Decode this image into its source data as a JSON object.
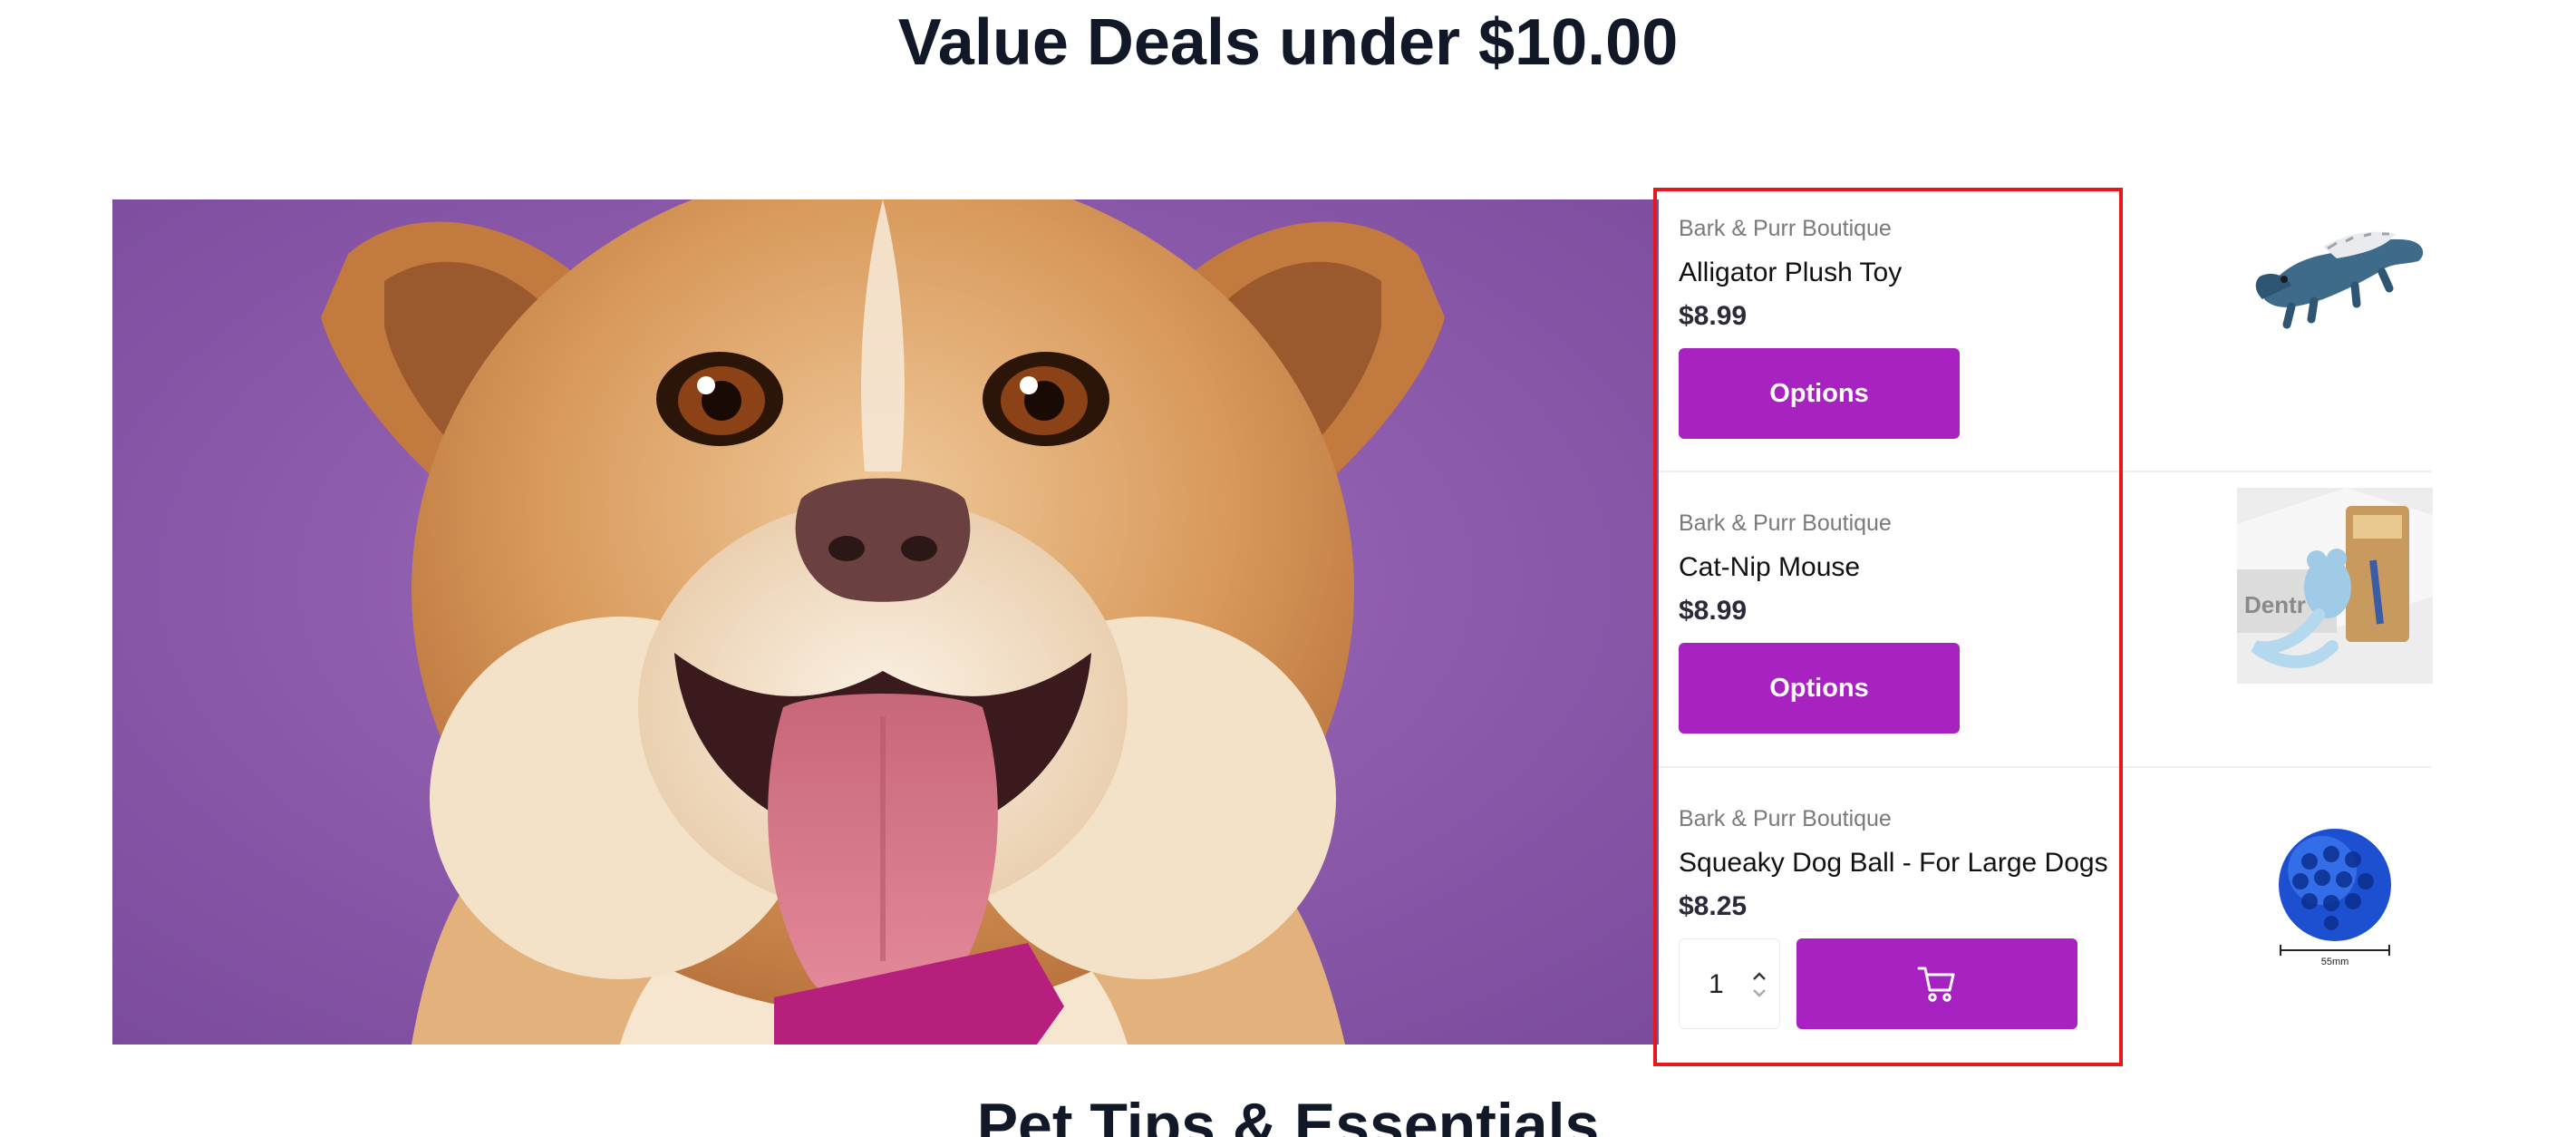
{
  "sections": {
    "value_deals_title": "Value Deals under $10.00",
    "pet_tips_title": "Pet Tips & Essentials"
  },
  "hero": {
    "image": "smiling-dog-portrait",
    "background_color": "#8a55a8"
  },
  "products": [
    {
      "vendor": "Bark & Purr Boutique",
      "name": "Alligator Plush Toy",
      "price": "$8.99",
      "button_label": "Options",
      "image": "alligator-plush-toy"
    },
    {
      "vendor": "Bark & Purr Boutique",
      "name": "Cat-Nip Mouse",
      "price": "$8.99",
      "button_label": "Options",
      "image": "cat-nip-mouse"
    },
    {
      "vendor": "Bark & Purr Boutique",
      "name": "Squeaky Dog Ball - For Large Dogs",
      "price": "$8.25",
      "quantity": "1",
      "cart_icon": "cart-icon",
      "image": "squeaky-dog-ball",
      "image_caption": "55mm"
    }
  ],
  "colors": {
    "accent": "#a722c0",
    "highlight_border": "#e8161d",
    "title_text": "#111827",
    "vendor_text": "#7a7a7a"
  }
}
